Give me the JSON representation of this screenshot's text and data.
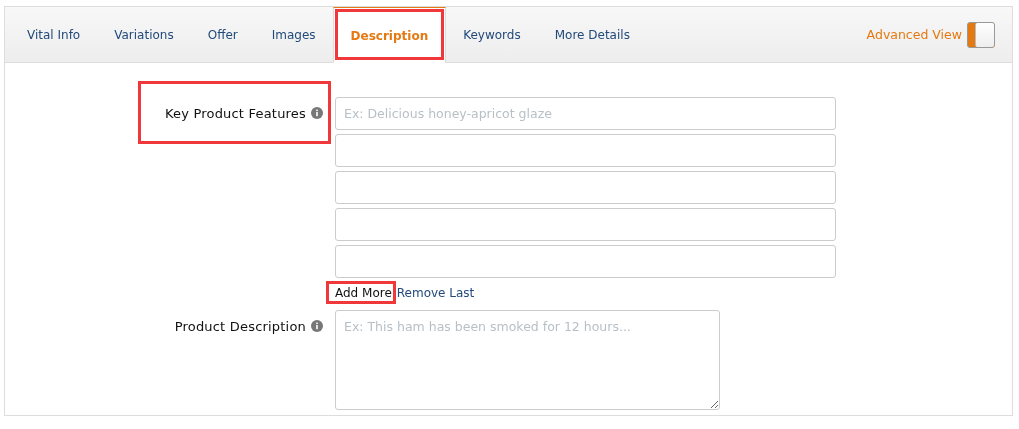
{
  "tabs": [
    {
      "label": "Vital Info",
      "selected": false,
      "highlighted": false
    },
    {
      "label": "Variations",
      "selected": false,
      "highlighted": false
    },
    {
      "label": "Offer",
      "selected": false,
      "highlighted": false
    },
    {
      "label": "Images",
      "selected": false,
      "highlighted": false
    },
    {
      "label": "Description",
      "selected": true,
      "highlighted": true
    },
    {
      "label": "Keywords",
      "selected": false,
      "highlighted": false
    },
    {
      "label": "More Details",
      "selected": false,
      "highlighted": false
    }
  ],
  "advanced_view": {
    "label": "Advanced View",
    "on": true
  },
  "key_product_features": {
    "label": "Key Product Features",
    "highlighted": true,
    "fields": [
      {
        "kind": "text",
        "placeholder": "Ex: Delicious honey-apricot glaze"
      },
      {
        "kind": "text"
      },
      {
        "kind": "text"
      },
      {
        "kind": "text"
      },
      {
        "kind": "text"
      }
    ],
    "actions": [
      {
        "label": "Add More",
        "kind": "button",
        "highlighted": true
      },
      {
        "label": "Remove Last",
        "kind": "link",
        "highlighted": false
      }
    ]
  },
  "product_description": {
    "label": "Product Description",
    "placeholder": "Ex: This ham has been smoked for 12 hours..."
  }
}
